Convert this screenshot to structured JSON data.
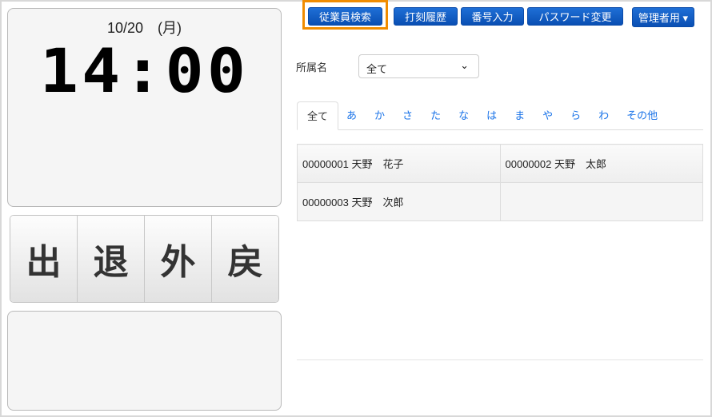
{
  "clock": {
    "date": "10/20　(月)",
    "time": "14:00"
  },
  "punch": [
    {
      "label": "出"
    },
    {
      "label": "退"
    },
    {
      "label": "外"
    },
    {
      "label": "戻"
    }
  ],
  "toolbar": {
    "employee_search": "従業員検索",
    "punch_history": "打刻履歴",
    "number_input": "番号入力",
    "password_change": "パスワード変更",
    "admin": "管理者用 ▾"
  },
  "filter": {
    "label": "所属名",
    "value": "全て"
  },
  "tabs": [
    "全て",
    "あ",
    "か",
    "さ",
    "た",
    "な",
    "は",
    "ま",
    "や",
    "ら",
    "わ",
    "その他"
  ],
  "employees": [
    [
      "00000001 天野　花子",
      "00000002 天野　太郎"
    ],
    [
      "00000003 天野　次郎",
      ""
    ]
  ]
}
